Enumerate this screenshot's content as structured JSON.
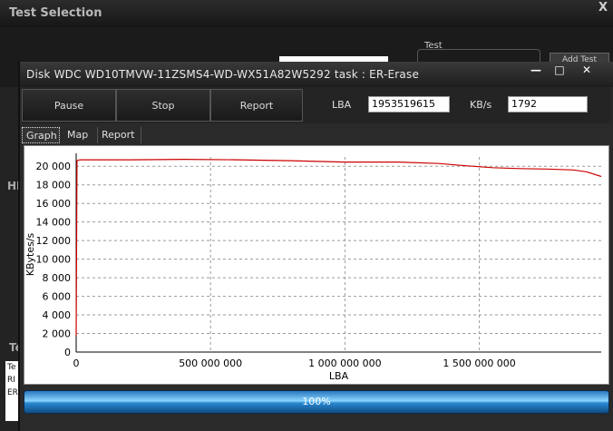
{
  "background_window": {
    "title": "Test Selection",
    "close_label": "X",
    "test_group_label": "Test",
    "add_button_label": "Add Test",
    "hd_label": "HD",
    "te_label": "Te",
    "table_rows": [
      "Te",
      "RI",
      "ER"
    ]
  },
  "dialog": {
    "title": "Disk WDC WD10TMVW-11ZSMS4-WD-WX51A82W5292   task : ER-Erase",
    "minimize_label": "—",
    "maximize_label": "□",
    "close_label": "✕"
  },
  "toolbar": {
    "pause_label": "Pause",
    "stop_label": "Stop",
    "report_label": "Report",
    "lba_label": "LBA",
    "lba_value": "1953519615",
    "kbs_label": "KB/s",
    "kbs_value": "1792"
  },
  "tabs": [
    {
      "label": "Graph",
      "active": true
    },
    {
      "label": "Map",
      "active": false
    },
    {
      "label": "Report",
      "active": false
    }
  ],
  "progress": {
    "label": "100%",
    "value": 1.0
  },
  "colors": {
    "series": "#cc0000",
    "grid": "#9a9a9a"
  },
  "chart_data": {
    "type": "line",
    "xlabel": "LBA",
    "ylabel": "KBytes/s",
    "xlim": [
      0,
      1953519615
    ],
    "ylim": [
      0,
      21000
    ],
    "x_ticks": [
      0,
      500000000,
      1000000000,
      1500000000
    ],
    "x_tick_labels": [
      "0",
      "500 000 000",
      "1 000 000 000",
      "1 500 000 000"
    ],
    "y_ticks": [
      0,
      2000,
      4000,
      6000,
      8000,
      10000,
      12000,
      14000,
      16000,
      18000,
      20000
    ],
    "y_tick_labels": [
      "0",
      "2 000",
      "4 000",
      "6 000",
      "8 000",
      "10 000",
      "12 000",
      "14 000",
      "16 000",
      "18 000",
      "20 000"
    ],
    "grid": true,
    "series": [
      {
        "x": [
          0,
          3000000,
          8000000,
          15000000,
          50000000,
          200000000,
          400000000,
          600000000,
          800000000,
          1000000000,
          1200000000,
          1350000000,
          1450000000,
          1550000000,
          1650000000,
          1750000000,
          1850000000,
          1900000000,
          1953519615
        ],
        "y": [
          1800,
          20600,
          20650,
          20700,
          20700,
          20700,
          20750,
          20700,
          20600,
          20450,
          20450,
          20300,
          20050,
          19850,
          19750,
          19700,
          19600,
          19400,
          18900
        ]
      }
    ]
  }
}
